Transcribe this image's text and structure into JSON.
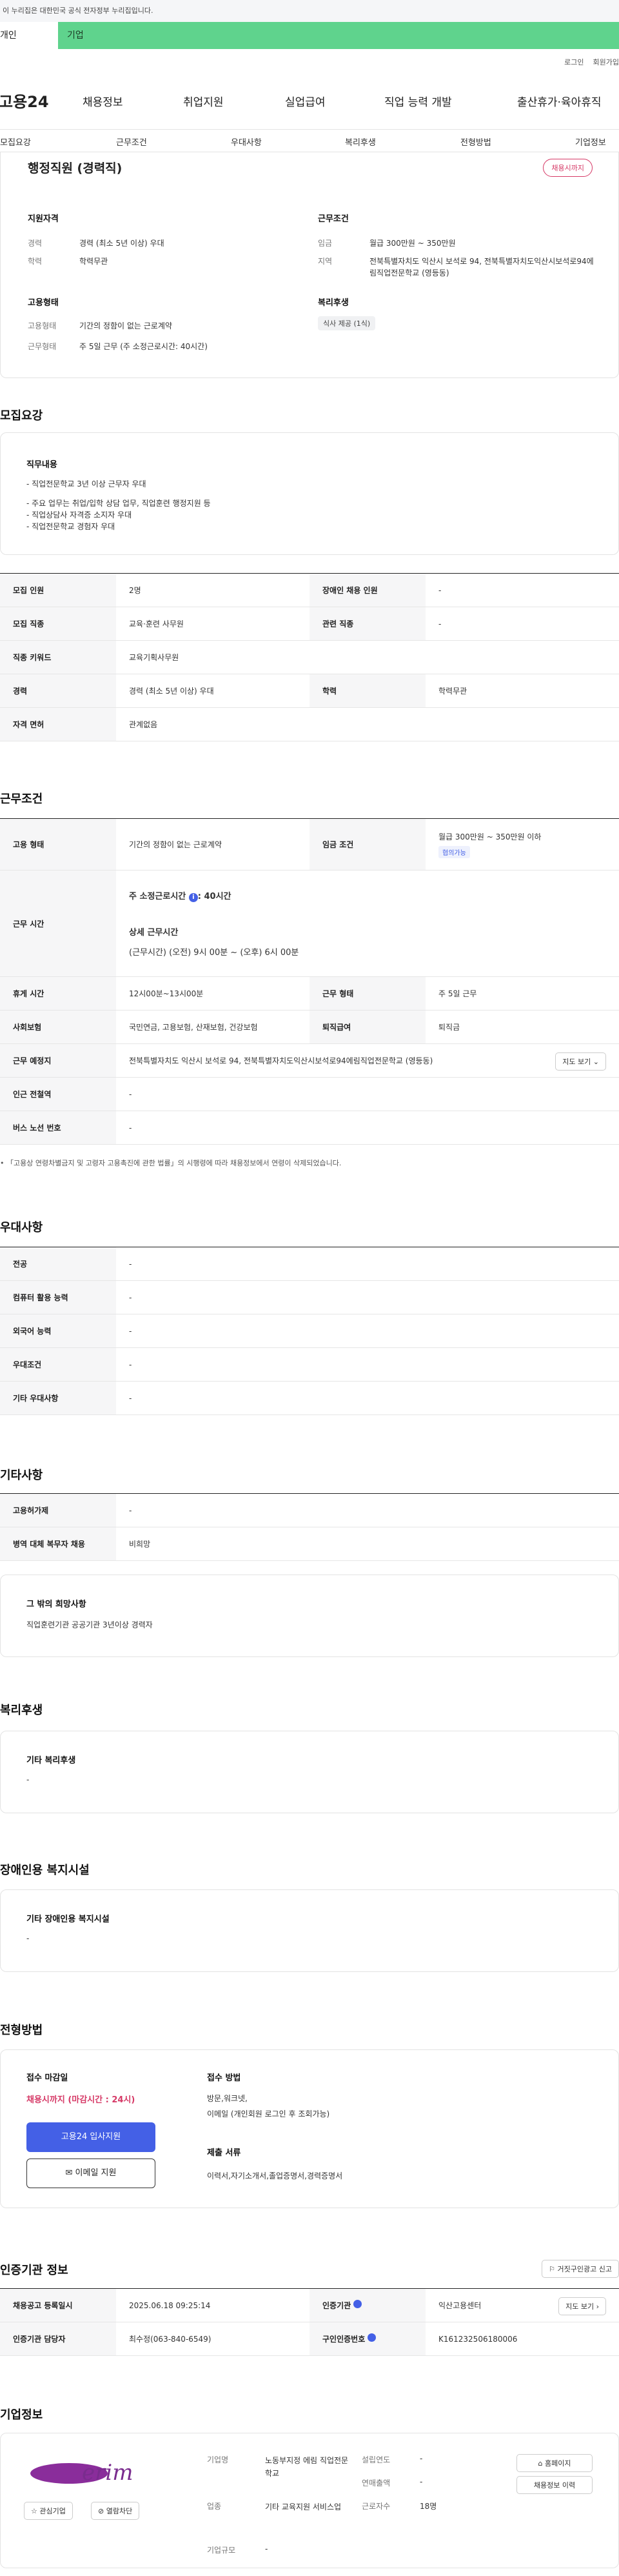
{
  "gov_banner": "이 누리집은 대한민국 공식 전자정부 누리집입니다.",
  "top_tabs": {
    "person": "개인",
    "corp": "기업"
  },
  "util": {
    "login": "로그인",
    "join": "회원가입"
  },
  "gnb": {
    "logo": "고용24",
    "menu": [
      "채용정보",
      "취업지원",
      "실업급여",
      "직업 능력 개발",
      "출산휴가·육아휴직"
    ]
  },
  "subnav": [
    "모집요강",
    "근무조건",
    "우대사항",
    "복리후생",
    "전형방법",
    "기업정보"
  ],
  "summary": {
    "title": "행정직원 (경력직)",
    "badge": "채용시까지",
    "qual_head": "지원자격",
    "qual": [
      {
        "k": "경력",
        "v": "경력 (최소 5년 이상) 우대"
      },
      {
        "k": "학력",
        "v": "학력무관"
      }
    ],
    "work_head": "근무조건",
    "work": [
      {
        "k": "임금",
        "v": "월급 300만원 ~ 350만원"
      },
      {
        "k": "지역",
        "v": "전북특별자치도 익산시 보석로 94, 전북특별자치도익산시보석로94에림직업전문학교 (영등동)"
      }
    ],
    "emp_head": "고용형태",
    "emp": [
      {
        "k": "고용형태",
        "v": "기간의 정함이 없는 근로계약"
      },
      {
        "k": "근무형태",
        "v": "주 5일 근무 (주 소정근로시간: 40시간)"
      }
    ],
    "welfare_head": "복리후생",
    "welfare_chip": "식사 제공 (1식)"
  },
  "recruit": {
    "title": "모집요강",
    "duty_head": "직무내용",
    "duty_lines": [
      "- 직업전문학교 3년 이상 근무자 우대",
      "",
      "- 주요 업무는 취업/입학 상담 업무, 직업훈련 행정지원 등",
      "- 직업상담사 자격증 소지자  우대",
      "- 직업전문학교 경험자 우대"
    ],
    "rows": [
      [
        {
          "k": "모집 인원",
          "v": "2명"
        },
        {
          "k": "장애인 채용 인원",
          "v": "-"
        }
      ],
      [
        {
          "k": "모집 직종",
          "v": "교육·훈련 사무원"
        },
        {
          "k": "관련 직종",
          "v": "-"
        }
      ],
      [
        {
          "k": "직종 키워드",
          "v": "교육기획사무원"
        }
      ],
      [
        {
          "k": "경력",
          "v": "경력 (최소 5년 이상) 우대"
        },
        {
          "k": "학력",
          "v": "학력무관"
        }
      ],
      [
        {
          "k": "자격 면허",
          "v": "관계없음"
        }
      ]
    ]
  },
  "work": {
    "title": "근무조건",
    "emp_type_k": "고용 형태",
    "emp_type_v": "기간의 정함이 없는 근로계약",
    "wage_k": "임금 조건",
    "wage_v": "월급 300만원 ~ 350만원 이하",
    "wage_chip": "협의가능",
    "time_k": "근무 시간",
    "time_main": "주 소정근로시간",
    "time_info": "i",
    "time_hours": ": 40시간",
    "time_detail_head": "상세 근무시간",
    "time_detail": "(근무시간) (오전) 9시 00분 ~ (오후) 6시 00분",
    "rest_k": "휴게 시간",
    "rest_v": "12시00분~13시00분",
    "form_k": "근무 형태",
    "form_v": "주 5일 근무",
    "ins_k": "사회보험",
    "ins_v": "국민연금, 고용보험, 산재보험, 건강보험",
    "sev_k": "퇴직급여",
    "sev_v": "퇴직금",
    "loc_k": "근무 예정지",
    "loc_v": "전북특별자치도 익산시 보석로 94, 전북특별자치도익산시보석로94에림직업전문학교 (영등동)",
    "map_btn": "지도 보기",
    "sub_k": "인근 전철역",
    "sub_v": "-",
    "bus_k": "버스 노선 번호",
    "bus_v": "-",
    "notice": "「고용상 연령차별금지 및 고령자 고용촉진에 관한 법률」의 시행령에 따라 채용정보에서 연령이 삭제되었습니다."
  },
  "prefer": {
    "title": "우대사항",
    "rows": [
      {
        "k": "전공",
        "v": "-"
      },
      {
        "k": "컴퓨터 활용 능력",
        "v": "-"
      },
      {
        "k": "외국어 능력",
        "v": "-"
      },
      {
        "k": "우대조건",
        "v": "-"
      },
      {
        "k": "기타 우대사항",
        "v": "-"
      }
    ]
  },
  "etc": {
    "title": "기타사항",
    "rows": [
      {
        "k": "고용허가제",
        "v": "-"
      },
      {
        "k": "병역 대체 복무자 채용",
        "v": "비희망"
      }
    ],
    "box_head": "그 밖의 희망사항",
    "box_v": "직업훈련기관 공공기관 3년이상 경력자"
  },
  "welfare": {
    "title": "복리후생",
    "box_head": "기타 복리후생",
    "box_v": "-"
  },
  "disab": {
    "title": "장애인용 복지시설",
    "box_head": "기타 장애인용 복지시설",
    "box_v": "-"
  },
  "process": {
    "title": "전형방법",
    "deadline_head": "접수 마감일",
    "deadline_v": "채용시까지 (마감시간 : 24시)",
    "apply_btn": "고용24 입사지원",
    "email_btn": "이메일 지원",
    "method_head": "접수 방법",
    "method_v1": "방문,워크넷,",
    "method_v2": "이메일 (개인회원 로그인 후 조회가능)",
    "docs_head": "제출 서류",
    "docs_v": "이력서,자기소개서,졸업증명서,경력증명서"
  },
  "cert": {
    "title": "인증기관 정보",
    "report_btn": "거짓구인광고 신고",
    "rows": [
      [
        {
          "k": "채용공고 등록일시",
          "v": "2025.06.18 09:25:14"
        },
        {
          "k": "인증기관",
          "v": "익산고용센터",
          "btn": "지도 보기"
        }
      ],
      [
        {
          "k": "인증기관 담당자",
          "v": "최수정(063-840-6549)"
        },
        {
          "k": "구인인증번호",
          "v": "K161232506180006"
        }
      ]
    ]
  },
  "company": {
    "title": "기업정보",
    "logo_text": "erim",
    "fav_btn": "관심기업",
    "block_btn": "열람차단",
    "rows": [
      {
        "k": "기업명",
        "v": "노동부지정 에림 직업전문학교",
        "k2": "설립연도",
        "v2": "-"
      },
      {
        "k": "업종",
        "v": "기타 교육지원 서비스업",
        "k2": "연매출액",
        "v2": "-"
      },
      {
        "k": "",
        "v": "",
        "k2": "근로자수",
        "v2": "18명"
      },
      {
        "k": "기업규모",
        "v": "-",
        "k2": "",
        "v2": ""
      }
    ],
    "home_btn": "홈페이지",
    "list_btn": "채용정보 이력"
  },
  "colors": {
    "accent": "#4460e6",
    "green": "#5fd38d",
    "red": "#d63a67"
  }
}
